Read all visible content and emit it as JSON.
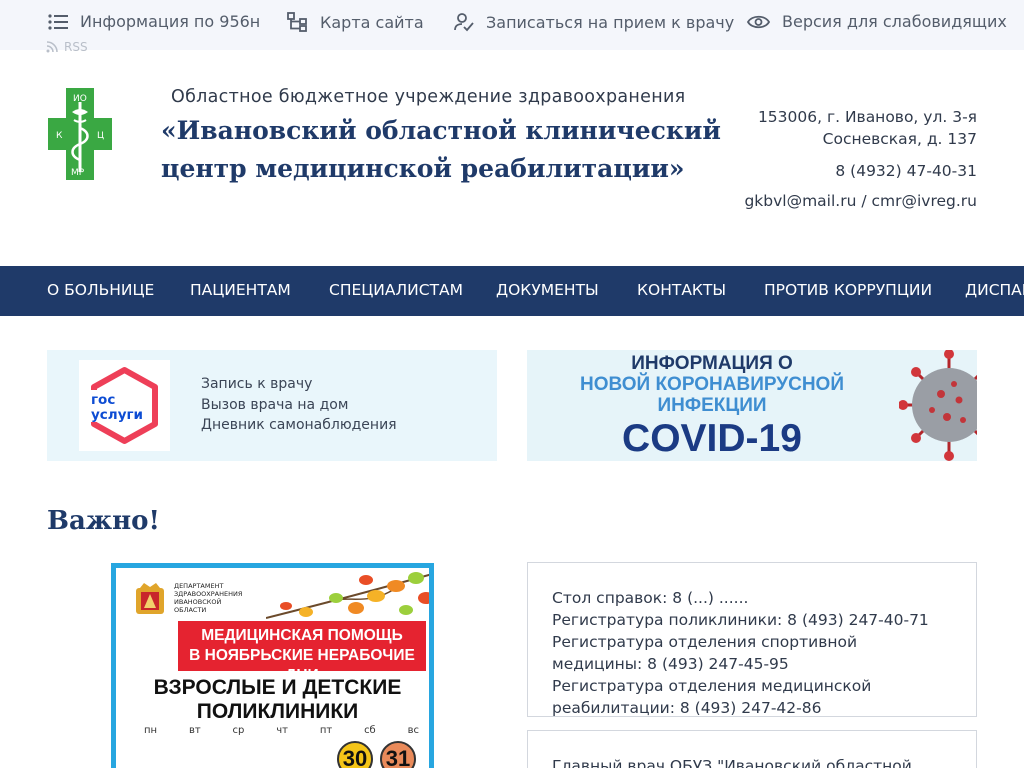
{
  "topbar": {
    "items": [
      {
        "label": "Информация по 956н",
        "icon": "list-icon"
      },
      {
        "label": "Карта сайта",
        "icon": "sitemap-icon"
      },
      {
        "label": "Записаться на прием к врачу",
        "icon": "user-check-icon"
      },
      {
        "label": "Версия для слабовидящих",
        "icon": "eye-icon"
      }
    ],
    "rss_label": "RSS"
  },
  "header": {
    "logo": {
      "letters": [
        "ИО",
        "К",
        "Ц",
        "МР"
      ],
      "colors": {
        "cross": "#3aa843",
        "emblem": "#ffffff"
      }
    },
    "subtitle": "Областное бюджетное учреждение здравоохранения",
    "title": "«Ивановский областной клинический центр медицинской реабилитации»",
    "address": "153006, г. Иваново, ул. 3-я Сосневская, д. 137",
    "phone": "8 (4932) 47-40-31",
    "email": "gkbvl@mail.ru / cmr@ivreg.ru"
  },
  "nav": {
    "items": [
      "О БОЛЬНИЦЕ",
      "ПАЦИЕНТАМ",
      "СПЕЦИАЛИСТАМ",
      "ДОКУМЕНТЫ",
      "КОНТАКТЫ",
      "ПРОТИВ КОРРУПЦИИ",
      "ДИСПАН"
    ]
  },
  "banners": {
    "gosuslugi": {
      "logo_line1": "гос",
      "logo_line2": "услуги",
      "lines": [
        "Запись к врачу",
        "Вызов врача на дом",
        "Дневник самонаблюдения"
      ]
    },
    "covid": {
      "line1": "ИНФОРМАЦИЯ О",
      "line2": "НОВОЙ КОРОНАВИРУСНОЙ",
      "line3": "ИНФЕКЦИИ",
      "line4": "COVID-19"
    }
  },
  "important": {
    "heading": "Важно!",
    "poster": {
      "dept": "ДЕПАРТАМЕНТ ЗДРАВООХРАНЕНИЯ ИВАНОВСКОЙ ОБЛАСТИ",
      "red_line1": "МЕДИЦИНСКАЯ ПОМОЩЬ",
      "red_line2": "В НОЯБРЬСКИЕ НЕРАБОЧИЕ ДНИ",
      "big_line1": "ВЗРОСЛЫЕ И ДЕТСКИЕ",
      "big_line2": "ПОЛИКЛИНИКИ",
      "days": [
        "пн",
        "вт",
        "ср",
        "чт",
        "пт",
        "сб",
        "вс"
      ],
      "dates": [
        "30",
        "31"
      ]
    },
    "info_lines": [
      "Стол справок: 8 (...) ......",
      "Регистратура поликлиники: 8 (493) 247-40-71",
      "Регистратура отделения спортивной медицины: 8 (493) 247-45-95",
      "Регистратура отделения медицинской реабилитации: 8 (493) 247-42-86"
    ],
    "chief_doctor_line": "Главный врач ОБУЗ \"Ивановский областной"
  }
}
